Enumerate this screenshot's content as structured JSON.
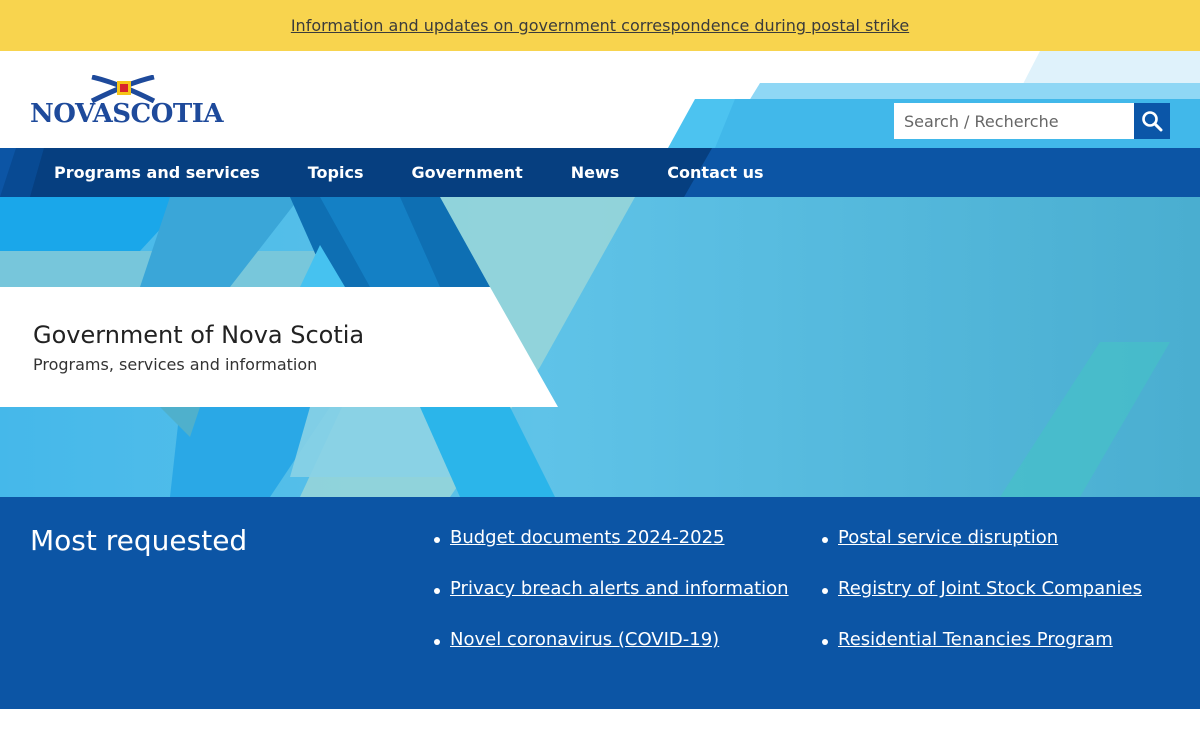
{
  "alert": {
    "text": "Information and updates on government correspondence during postal strike"
  },
  "header": {
    "logo_text": "NOVASCOTIA",
    "search": {
      "placeholder": "Search / Recherche",
      "value": ""
    }
  },
  "nav": {
    "items": [
      {
        "label": "Programs and services"
      },
      {
        "label": "Topics"
      },
      {
        "label": "Government"
      },
      {
        "label": "News"
      },
      {
        "label": "Contact us"
      }
    ]
  },
  "hero": {
    "title": "Government of Nova Scotia",
    "subtitle": "Programs, services and information"
  },
  "requested": {
    "heading": "Most requested",
    "col1": [
      {
        "label": "Budget documents 2024-2025"
      },
      {
        "label": "Privacy breach alerts and information"
      },
      {
        "label": "Novel coronavirus (COVID-19)"
      }
    ],
    "col2": [
      {
        "label": "Postal service disruption"
      },
      {
        "label": "Registry of Joint Stock Companies"
      },
      {
        "label": "Residential Tenancies Program"
      }
    ]
  },
  "colors": {
    "alert_bg": "#f8d44e",
    "primary_blue": "#0c55a5",
    "hero_blue": "#4fb9e0"
  },
  "icons": {
    "search": "magnifier-icon",
    "logo": "saltire-flag-icon"
  }
}
